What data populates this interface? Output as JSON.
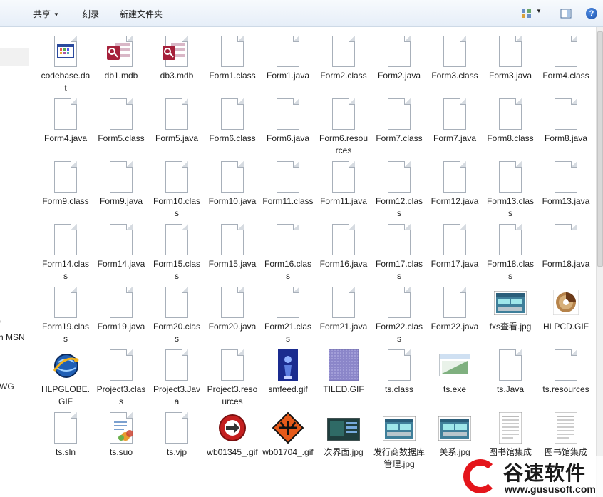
{
  "toolbar": {
    "share_label": "共享",
    "burn_label": "刻录",
    "new_folder_label": "新建文件夹",
    "view_icon": "view-options-icon",
    "preview_pane_icon": "preview-pane-icon",
    "help_glyph": "?"
  },
  "nav": {
    "items": [
      ")",
      "n MSN",
      "WG"
    ]
  },
  "files": [
    {
      "name": "codebase.dat",
      "icon": "dat-file-icon"
    },
    {
      "name": "db1.mdb",
      "icon": "access-db-icon"
    },
    {
      "name": "db3.mdb",
      "icon": "access-db-icon"
    },
    {
      "name": "Form1.class",
      "icon": "blank-file-icon"
    },
    {
      "name": "Form1.java",
      "icon": "blank-file-icon"
    },
    {
      "name": "Form2.class",
      "icon": "blank-file-icon"
    },
    {
      "name": "Form2.java",
      "icon": "blank-file-icon"
    },
    {
      "name": "Form3.class",
      "icon": "blank-file-icon"
    },
    {
      "name": "Form3.java",
      "icon": "blank-file-icon"
    },
    {
      "name": "Form4.class",
      "icon": "blank-file-icon"
    },
    {
      "name": "Form4.java",
      "icon": "blank-file-icon"
    },
    {
      "name": "Form5.class",
      "icon": "blank-file-icon"
    },
    {
      "name": "Form5.java",
      "icon": "blank-file-icon"
    },
    {
      "name": "Form6.class",
      "icon": "blank-file-icon"
    },
    {
      "name": "Form6.java",
      "icon": "blank-file-icon"
    },
    {
      "name": "Form6.resources",
      "icon": "blank-file-icon"
    },
    {
      "name": "Form7.class",
      "icon": "blank-file-icon"
    },
    {
      "name": "Form7.java",
      "icon": "blank-file-icon"
    },
    {
      "name": "Form8.class",
      "icon": "blank-file-icon"
    },
    {
      "name": "Form8.java",
      "icon": "blank-file-icon"
    },
    {
      "name": "Form9.class",
      "icon": "blank-file-icon"
    },
    {
      "name": "Form9.java",
      "icon": "blank-file-icon"
    },
    {
      "name": "Form10.class",
      "icon": "blank-file-icon"
    },
    {
      "name": "Form10.java",
      "icon": "blank-file-icon"
    },
    {
      "name": "Form11.class",
      "icon": "blank-file-icon"
    },
    {
      "name": "Form11.java",
      "icon": "blank-file-icon"
    },
    {
      "name": "Form12.class",
      "icon": "blank-file-icon"
    },
    {
      "name": "Form12.java",
      "icon": "blank-file-icon"
    },
    {
      "name": "Form13.class",
      "icon": "blank-file-icon"
    },
    {
      "name": "Form13.java",
      "icon": "blank-file-icon"
    },
    {
      "name": "Form14.class",
      "icon": "blank-file-icon"
    },
    {
      "name": "Form14.java",
      "icon": "blank-file-icon"
    },
    {
      "name": "Form15.class",
      "icon": "blank-file-icon"
    },
    {
      "name": "Form15.java",
      "icon": "blank-file-icon"
    },
    {
      "name": "Form16.class",
      "icon": "blank-file-icon"
    },
    {
      "name": "Form16.java",
      "icon": "blank-file-icon"
    },
    {
      "name": "Form17.class",
      "icon": "blank-file-icon"
    },
    {
      "name": "Form17.java",
      "icon": "blank-file-icon"
    },
    {
      "name": "Form18.class",
      "icon": "blank-file-icon"
    },
    {
      "name": "Form18.java",
      "icon": "blank-file-icon"
    },
    {
      "name": "Form19.class",
      "icon": "blank-file-icon"
    },
    {
      "name": "Form19.java",
      "icon": "blank-file-icon"
    },
    {
      "name": "Form20.class",
      "icon": "blank-file-icon"
    },
    {
      "name": "Form20.java",
      "icon": "blank-file-icon"
    },
    {
      "name": "Form21.class",
      "icon": "blank-file-icon"
    },
    {
      "name": "Form21.java",
      "icon": "blank-file-icon"
    },
    {
      "name": "Form22.class",
      "icon": "blank-file-icon"
    },
    {
      "name": "Form22.java",
      "icon": "blank-file-icon"
    },
    {
      "name": "fxs查看.jpg",
      "icon": "screenshot-image-icon"
    },
    {
      "name": "HLPCD.GIF",
      "icon": "cd-image-icon"
    },
    {
      "name": "HLPGLOBE.GIF",
      "icon": "globe-image-icon"
    },
    {
      "name": "Project3.class",
      "icon": "blank-file-icon"
    },
    {
      "name": "Project3.Java",
      "icon": "blank-file-icon"
    },
    {
      "name": "Project3.resources",
      "icon": "blank-file-icon"
    },
    {
      "name": "smfeed.gif",
      "icon": "blue-figure-image-icon"
    },
    {
      "name": "TILED.GIF",
      "icon": "tiled-texture-image-icon"
    },
    {
      "name": "ts.class",
      "icon": "blank-file-icon"
    },
    {
      "name": "ts.exe",
      "icon": "exe-window-icon"
    },
    {
      "name": "ts.Java",
      "icon": "blank-file-icon"
    },
    {
      "name": "ts.resources",
      "icon": "blank-file-icon"
    },
    {
      "name": "ts.sln",
      "icon": "blank-file-icon"
    },
    {
      "name": "ts.suo",
      "icon": "suo-file-icon"
    },
    {
      "name": "ts.vjp",
      "icon": "blank-file-icon"
    },
    {
      "name": "wb01345_.gif",
      "icon": "red-arrow-image-icon"
    },
    {
      "name": "wb01704_.gif",
      "icon": "airplane-sign-image-icon"
    },
    {
      "name": "次界面.jpg",
      "icon": "dark-screenshot-image-icon"
    },
    {
      "name": "发行商数据库管理.jpg",
      "icon": "screenshot-image-icon"
    },
    {
      "name": "关系.jpg",
      "icon": "screenshot-image-icon"
    },
    {
      "name": "图书馆集成",
      "icon": "document-image-icon"
    },
    {
      "name": "图书馆集成",
      "icon": "document-image-icon"
    }
  ],
  "watermark": {
    "brand": "谷速软件",
    "url": "www.gususoft.com"
  },
  "colors": {
    "toolbar_top": "#f7fafd",
    "toolbar_bottom": "#e6eef8",
    "watermark_red": "#e4151b"
  }
}
